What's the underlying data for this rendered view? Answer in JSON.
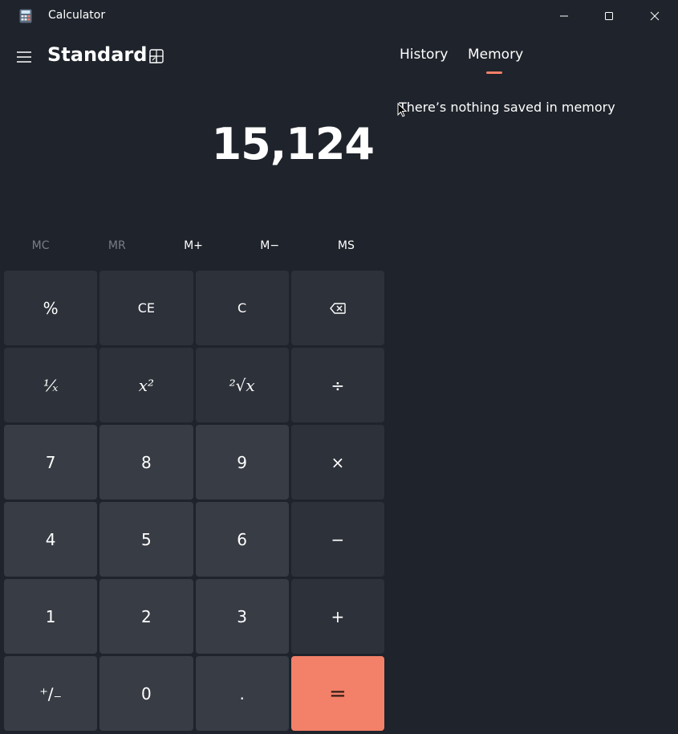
{
  "window": {
    "title": "Calculator",
    "icon": "calculator-app-icon",
    "controls": [
      "minimize-icon",
      "maximize-icon",
      "close-icon"
    ]
  },
  "header": {
    "mode_title": "Standard",
    "menu_icon": "hamburger-menu-icon",
    "keep_on_top_icon": "keep-on-top-icon"
  },
  "display": {
    "value": "15,124"
  },
  "memory_buttons": [
    {
      "label": "MC",
      "enabled": false
    },
    {
      "label": "MR",
      "enabled": false
    },
    {
      "label": "M+",
      "enabled": true
    },
    {
      "label": "M−",
      "enabled": true
    },
    {
      "label": "MS",
      "enabled": true
    }
  ],
  "keys": [
    {
      "label": "%",
      "name": "percent-button",
      "kind": "fn"
    },
    {
      "label": "CE",
      "name": "clear-entry-button",
      "kind": "fn"
    },
    {
      "label": "C",
      "name": "clear-button",
      "kind": "fn"
    },
    {
      "label": "",
      "name": "backspace-button",
      "kind": "fn",
      "icon": "backspace-icon"
    },
    {
      "label": "¹⁄ₓ",
      "name": "reciprocal-button",
      "kind": "fn"
    },
    {
      "label": "x²",
      "name": "square-button",
      "kind": "fn"
    },
    {
      "label": "²√x",
      "name": "square-root-button",
      "kind": "fn"
    },
    {
      "label": "÷",
      "name": "divide-button",
      "kind": "fn"
    },
    {
      "label": "7",
      "name": "digit-7-button",
      "kind": "num"
    },
    {
      "label": "8",
      "name": "digit-8-button",
      "kind": "num"
    },
    {
      "label": "9",
      "name": "digit-9-button",
      "kind": "num"
    },
    {
      "label": "×",
      "name": "multiply-button",
      "kind": "fn"
    },
    {
      "label": "4",
      "name": "digit-4-button",
      "kind": "num"
    },
    {
      "label": "5",
      "name": "digit-5-button",
      "kind": "num"
    },
    {
      "label": "6",
      "name": "digit-6-button",
      "kind": "num"
    },
    {
      "label": "−",
      "name": "minus-button",
      "kind": "fn"
    },
    {
      "label": "1",
      "name": "digit-1-button",
      "kind": "num"
    },
    {
      "label": "2",
      "name": "digit-2-button",
      "kind": "num"
    },
    {
      "label": "3",
      "name": "digit-3-button",
      "kind": "num"
    },
    {
      "label": "+",
      "name": "plus-button",
      "kind": "fn"
    },
    {
      "label": "⁺∕₋",
      "name": "negate-button",
      "kind": "num"
    },
    {
      "label": "0",
      "name": "digit-0-button",
      "kind": "num"
    },
    {
      "label": ".",
      "name": "decimal-button",
      "kind": "num"
    },
    {
      "label": "=",
      "name": "equals-button",
      "kind": "equals"
    }
  ],
  "panel": {
    "tabs": [
      {
        "label": "History",
        "active": false
      },
      {
        "label": "Memory",
        "active": true
      }
    ],
    "empty_message": "There’s nothing saved in memory"
  },
  "colors": {
    "background": "#1f232b",
    "function_key": "#2d3139",
    "number_key": "#383c44",
    "accent": "#f38068"
  }
}
